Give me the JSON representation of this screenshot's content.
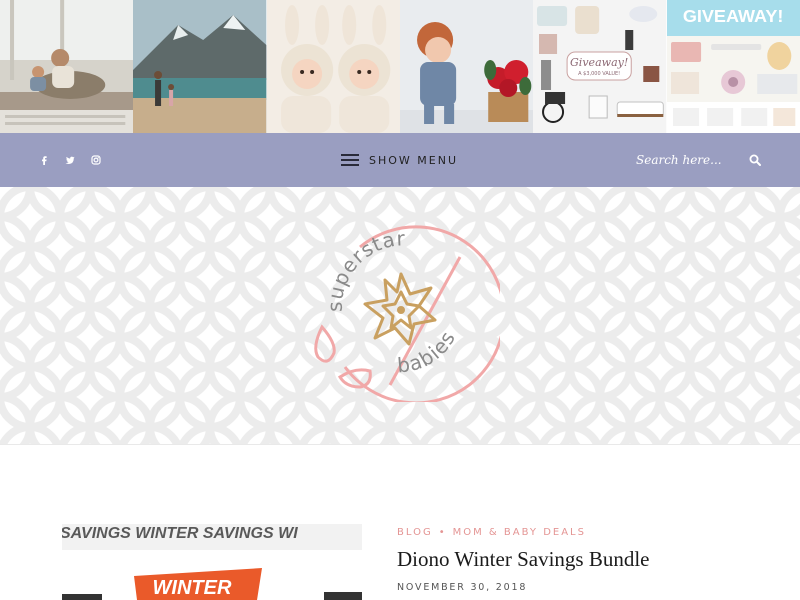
{
  "top_strip": {
    "images": [
      {
        "name": "photo-mother-child-window"
      },
      {
        "name": "photo-family-mountain-lake"
      },
      {
        "name": "photo-twin-babies-bunny-hats"
      },
      {
        "name": "photo-toddler-with-flowers"
      },
      {
        "name": "photo-giveaway-products",
        "badge_text": "Giveaway!",
        "sub_text": "A $3,000 VALUE!"
      },
      {
        "name": "photo-giveaway-banner",
        "headline": "GIVEAWAY!"
      }
    ]
  },
  "nav": {
    "social_icons": [
      "facebook-icon",
      "twitter-icon",
      "instagram-icon"
    ],
    "menu_label": "SHOW MENU",
    "search_placeholder": "Search here..."
  },
  "logo": {
    "word_top": "superstar",
    "word_bottom": "babies"
  },
  "post": {
    "categories": [
      "BLOG",
      "MOM & BABY DEALS"
    ],
    "title": "Diono Winter Savings Bundle",
    "date": "NOVEMBER 30, 2018",
    "thumb_text": "SAVINGS WINTER SAVINGS WI",
    "thumb_badge": "WINTER"
  },
  "colors": {
    "nav_bg": "#9a9ec1",
    "logo_pink": "#f1a8a8",
    "logo_gold": "#c9a060",
    "accent_pink": "#e49594"
  }
}
